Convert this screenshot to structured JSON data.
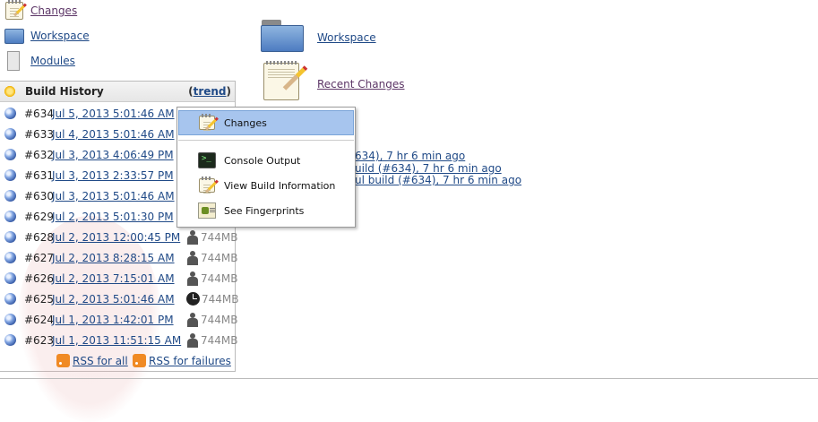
{
  "sidebar": {
    "tasks": [
      {
        "label": "Changes",
        "icon": "notepad-icon"
      },
      {
        "label": "Workspace",
        "icon": "folder-icon"
      },
      {
        "label": "Modules",
        "icon": "page-icon"
      }
    ]
  },
  "build_history": {
    "title": "Build History",
    "trend_open": "(",
    "trend_label": "trend",
    "trend_close": ")",
    "builds": [
      {
        "number": "#634",
        "date": "Jul 5, 2013 5:01:46 AM",
        "trigger": "",
        "size": ""
      },
      {
        "number": "#633",
        "date": "Jul 4, 2013 5:01:46 AM",
        "trigger": "",
        "size": ""
      },
      {
        "number": "#632",
        "date": "Jul 3, 2013 4:06:49 PM",
        "trigger": "",
        "size": ""
      },
      {
        "number": "#631",
        "date": "Jul 3, 2013 2:33:57 PM",
        "trigger": "",
        "size": ""
      },
      {
        "number": "#630",
        "date": "Jul 3, 2013 5:01:46 AM",
        "trigger": "",
        "size": ""
      },
      {
        "number": "#629",
        "date": "Jul 2, 2013 5:01:30 PM",
        "trigger": "",
        "size": ""
      },
      {
        "number": "#628",
        "date": "Jul 2, 2013 12:00:45 PM",
        "trigger": "user",
        "size": "744MB"
      },
      {
        "number": "#627",
        "date": "Jul 2, 2013 8:28:15 AM",
        "trigger": "user",
        "size": "744MB"
      },
      {
        "number": "#626",
        "date": "Jul 2, 2013 7:15:01 AM",
        "trigger": "user",
        "size": "744MB"
      },
      {
        "number": "#625",
        "date": "Jul 2, 2013 5:01:46 AM",
        "trigger": "timer",
        "size": "744MB"
      },
      {
        "number": "#624",
        "date": "Jul 1, 2013 1:42:01 PM",
        "trigger": "user",
        "size": "744MB"
      },
      {
        "number": "#623",
        "date": "Jul 1, 2013 11:51:15 AM",
        "trigger": "user",
        "size": "744MB"
      }
    ],
    "rss_all": "RSS for all",
    "rss_failures": "RSS for failures"
  },
  "main": {
    "workspace_label": "Workspace",
    "recent_changes_label": "Recent Changes",
    "permalinks": [
      "634), 7 hr 6 min ago",
      "uild (#634), 7 hr 6 min ago",
      "ul build (#634), 7 hr 6 min ago"
    ]
  },
  "context_menu": {
    "items": [
      {
        "label": "Changes",
        "icon": "notepad-icon",
        "selected": true
      },
      {
        "label": "Console Output",
        "icon": "terminal-icon",
        "selected": false
      },
      {
        "label": "View Build Information",
        "icon": "notepad-icon",
        "selected": false
      },
      {
        "label": "See Fingerprints",
        "icon": "fingerprint-icon",
        "selected": false
      }
    ]
  },
  "colors": {
    "link": "#204a87",
    "visited_link": "#5c3566",
    "menu_selection": "#a7c5ee",
    "rss_orange": "#f08a24"
  }
}
